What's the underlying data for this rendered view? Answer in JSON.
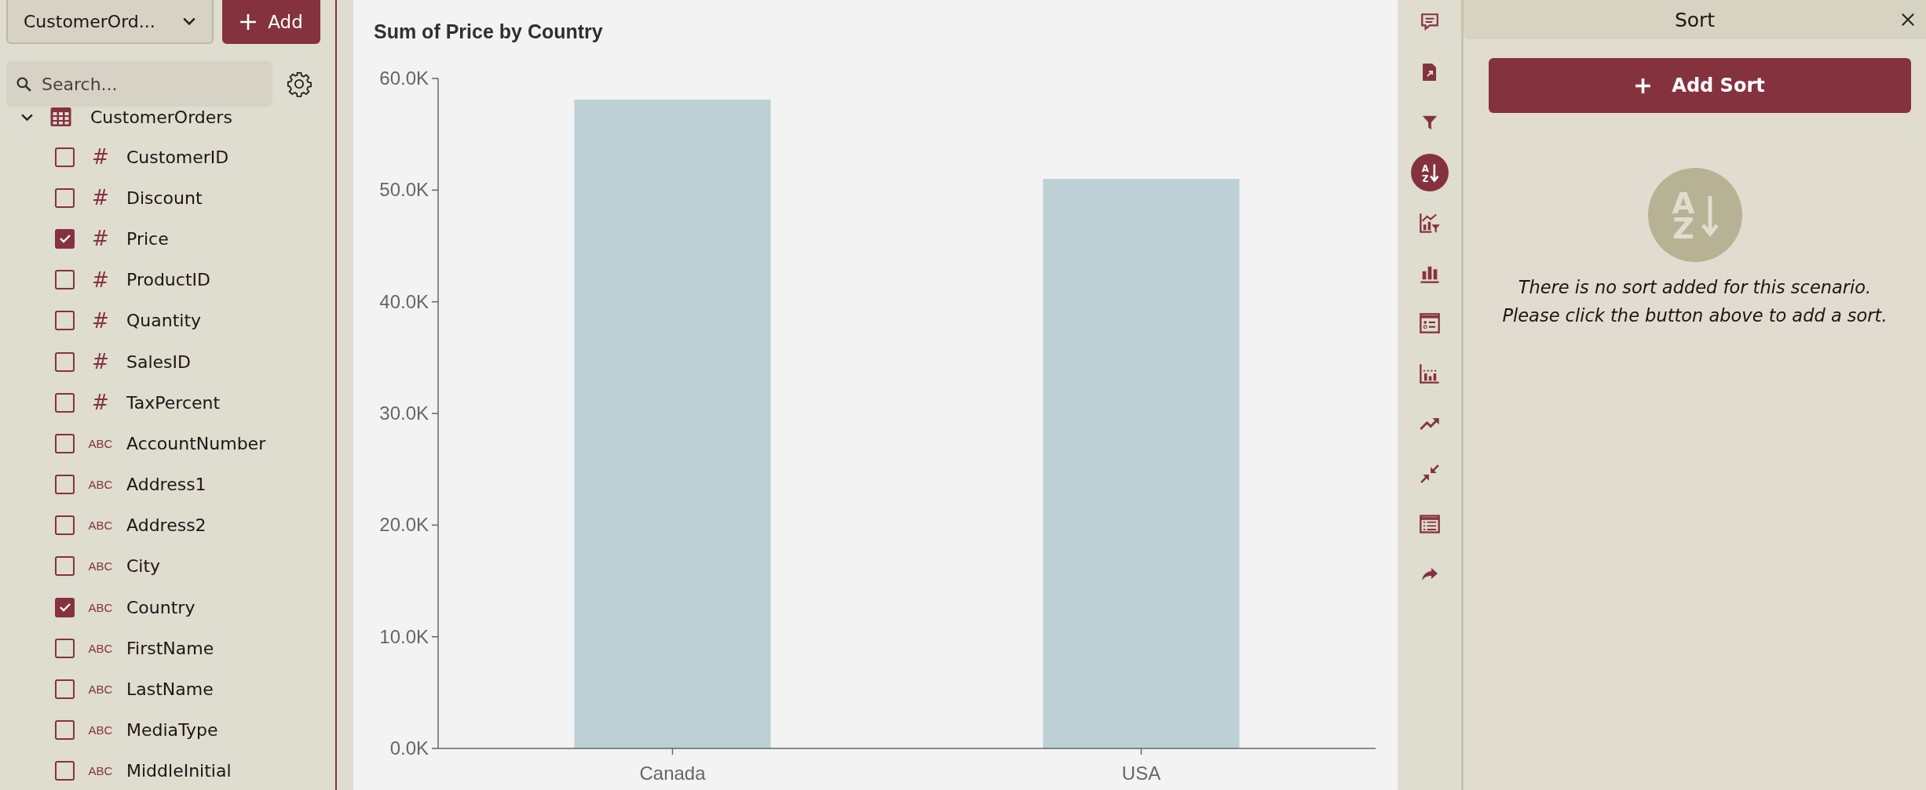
{
  "left_panel": {
    "dataset_dropdown": {
      "value": "CustomerOrd..."
    },
    "add_button": {
      "label": "Add"
    },
    "search": {
      "placeholder": "Search..."
    },
    "tree": [
      {
        "label": "CustomerOrders",
        "expanded": true,
        "children": [
          {
            "label": "CustomerID",
            "kind": "number",
            "type_label": "#",
            "checked": false
          },
          {
            "label": "Discount",
            "kind": "number",
            "type_label": "#",
            "checked": false
          },
          {
            "label": "Price",
            "kind": "number",
            "type_label": "#",
            "checked": true
          },
          {
            "label": "ProductID",
            "kind": "number",
            "type_label": "#",
            "checked": false
          },
          {
            "label": "Quantity",
            "kind": "number",
            "type_label": "#",
            "checked": false
          },
          {
            "label": "SalesID",
            "kind": "number",
            "type_label": "#",
            "checked": false
          },
          {
            "label": "TaxPercent",
            "kind": "number",
            "type_label": "#",
            "checked": false
          },
          {
            "label": "AccountNumber",
            "kind": "text",
            "type_label": "ABC",
            "checked": false
          },
          {
            "label": "Address1",
            "kind": "text",
            "type_label": "ABC",
            "checked": false
          },
          {
            "label": "Address2",
            "kind": "text",
            "type_label": "ABC",
            "checked": false
          },
          {
            "label": "City",
            "kind": "text",
            "type_label": "ABC",
            "checked": false
          },
          {
            "label": "Country",
            "kind": "text",
            "type_label": "ABC",
            "checked": true
          },
          {
            "label": "FirstName",
            "kind": "text",
            "type_label": "ABC",
            "checked": false
          },
          {
            "label": "LastName",
            "kind": "text",
            "type_label": "ABC",
            "checked": false
          },
          {
            "label": "MediaType",
            "kind": "text",
            "type_label": "ABC",
            "checked": false
          },
          {
            "label": "MiddleInitial",
            "kind": "text",
            "type_label": "ABC",
            "checked": false
          }
        ]
      }
    ]
  },
  "chart_panel": {
    "chart_data": {
      "type": "bar",
      "title": "Sum of Price by Country",
      "categories": [
        "Canada",
        "USA"
      ],
      "values": [
        58100,
        51000
      ],
      "ylim": [
        0,
        60000
      ],
      "yticks": [
        {
          "value": 0,
          "label": "0.0K"
        },
        {
          "value": 10000,
          "label": "10.0K"
        },
        {
          "value": 20000,
          "label": "20.0K"
        },
        {
          "value": 30000,
          "label": "30.0K"
        },
        {
          "value": 40000,
          "label": "40.0K"
        },
        {
          "value": 50000,
          "label": "50.0K"
        },
        {
          "value": 60000,
          "label": "60.0K"
        }
      ]
    }
  },
  "toolbar": [
    {
      "kind": "comment",
      "selected": false
    },
    {
      "kind": "export",
      "selected": false
    },
    {
      "kind": "filter",
      "selected": false
    },
    {
      "kind": "sort",
      "selected": true,
      "letters": [
        "A",
        "Z"
      ]
    },
    {
      "kind": "chart-filter",
      "selected": false
    },
    {
      "kind": "bar-chart",
      "selected": false
    },
    {
      "kind": "legend",
      "selected": false
    },
    {
      "kind": "histogram",
      "selected": false
    },
    {
      "kind": "trend",
      "selected": false
    },
    {
      "kind": "collapse",
      "selected": false
    },
    {
      "kind": "table",
      "selected": false
    },
    {
      "kind": "share",
      "selected": false
    }
  ],
  "sort_panel": {
    "title": "Sort",
    "add_button": {
      "label": "Add Sort"
    },
    "empty_icon_letters": [
      "A",
      "Z"
    ],
    "empty_message": [
      "There is no sort added for this scenario.",
      "Please click the button above to add a sort."
    ]
  }
}
